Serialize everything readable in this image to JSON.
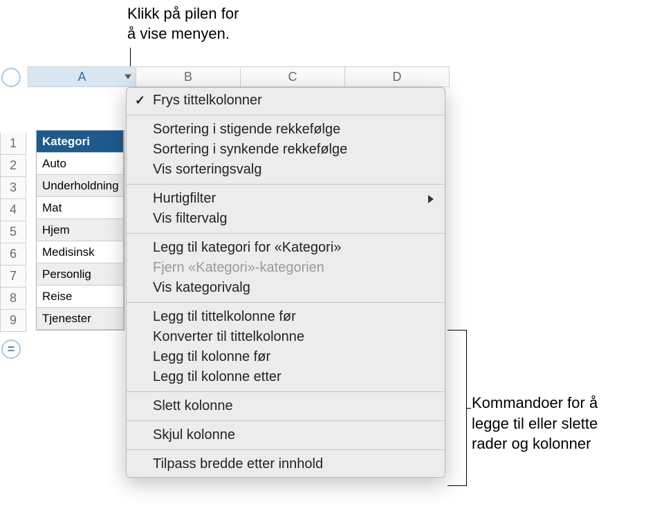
{
  "callouts": {
    "top": "Klikk på pilen for\nå vise menyen.",
    "right": "Kommandoer for å\nlegge til eller slette\nrader og kolonner"
  },
  "columns": [
    "A",
    "B",
    "C",
    "D"
  ],
  "rows": [
    "1",
    "2",
    "3",
    "4",
    "5",
    "6",
    "7",
    "8",
    "9"
  ],
  "equals": "=",
  "table": {
    "header": "Kategori",
    "cells": [
      "Auto",
      "Underholdning",
      "Mat",
      "Hjem",
      "Medisinsk",
      "Personlig",
      "Reise",
      "Tjenester"
    ]
  },
  "menu": {
    "freeze": "Frys tittelkolonner",
    "sortAsc": "Sortering i stigende rekkefølge",
    "sortDesc": "Sortering i synkende rekkefølge",
    "sortOptions": "Vis sorteringsvalg",
    "quickFilter": "Hurtigfilter",
    "filterOptions": "Vis filtervalg",
    "addCategory": "Legg til kategori for «Kategori»",
    "removeCategory": "Fjern «Kategori»-kategorien",
    "categoryOptions": "Vis kategorivalg",
    "addHeaderBefore": "Legg til tittelkolonne før",
    "convertHeader": "Konverter til tittelkolonne",
    "addColBefore": "Legg til kolonne før",
    "addColAfter": "Legg til kolonne etter",
    "deleteCol": "Slett kolonne",
    "hideCol": "Skjul kolonne",
    "fitWidth": "Tilpass bredde etter innhold"
  }
}
